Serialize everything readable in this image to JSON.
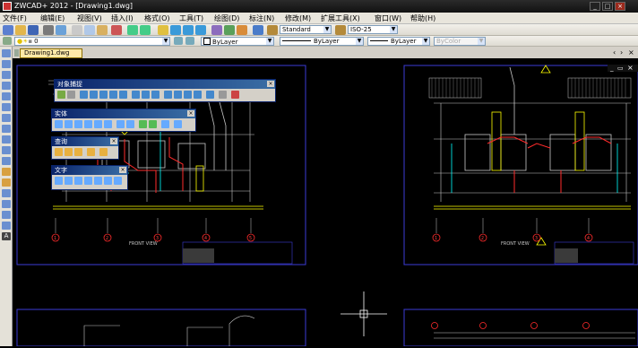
{
  "window": {
    "title": "ZWCAD+ 2012 - [Drawing1.dwg]",
    "minimize": "_",
    "maximize": "□",
    "close": "×"
  },
  "menu": [
    "文件(F)",
    "编辑(E)",
    "视图(V)",
    "插入(I)",
    "格式(O)",
    "工具(T)",
    "绘图(D)",
    "标注(N)",
    "修改(M)",
    "扩展工具(X)",
    "窗口(W)",
    "帮助(H)"
  ],
  "toolbar": {
    "text_style": "Standard",
    "dim_style": "ISO-25",
    "layer": "0",
    "color": "ByLayer",
    "linetype": "ByLayer",
    "lineweight": "ByLayer",
    "plot_style": "ByColor"
  },
  "tab": {
    "label": "Drawing1.dwg"
  },
  "palettes": {
    "osnap": {
      "title": "对象捕捉",
      "close": "×"
    },
    "solids": {
      "title": "实体",
      "close": "×"
    },
    "inquiry": {
      "title": "查询",
      "close": "×"
    },
    "text": {
      "title": "文字",
      "close": "×"
    }
  },
  "viewport_controls": {
    "prev": "‹",
    "next": "›",
    "restore": "▭",
    "close": "×"
  },
  "drawing_labels": {
    "left_view": "FRONT VIEW",
    "right_view": "FRONT VIEW"
  },
  "grid_markers": [
    "1",
    "2",
    "3",
    "4",
    "5"
  ],
  "colors": {
    "canvas": "#000000",
    "outline": "#3b3bd6",
    "ground": "#ffff00",
    "pipe": "#ff2b2b",
    "detail": "#c8c8c8"
  }
}
